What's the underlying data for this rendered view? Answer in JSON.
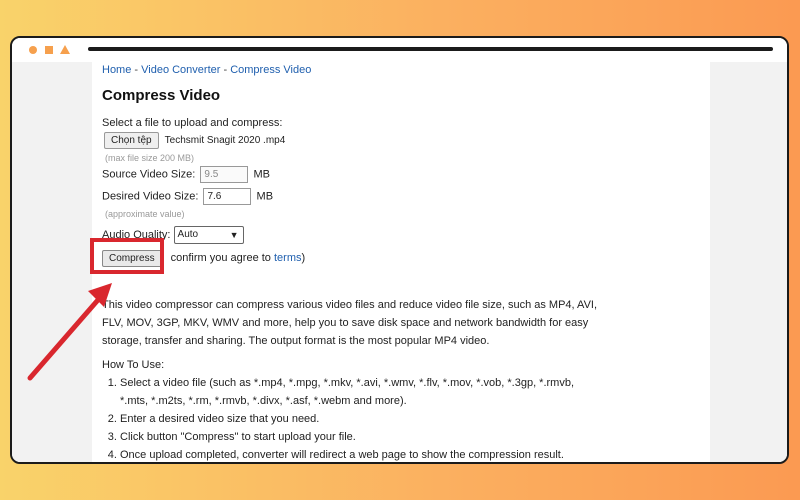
{
  "breadcrumb": {
    "home": "Home",
    "sep": " - ",
    "converter": "Video Converter",
    "current": "Compress Video"
  },
  "page_title": "Compress Video",
  "form": {
    "select_label": "Select a file to upload and compress:",
    "choose_button": "Chọn tệp",
    "file_name": "Techsmit Snagit 2020 .mp4",
    "max_size_hint": "(max file size 200 MB)",
    "source_label": "Source Video Size:",
    "source_value": "9.5",
    "unit": "MB",
    "desired_label": "Desired Video Size:",
    "desired_value": "7.6",
    "approx_hint": "(approximate value)",
    "audio_label": "Audio Quality:",
    "audio_value": "Auto",
    "compress_button": "Compress",
    "confirm_text": "confirm you agree to",
    "terms_link": "terms",
    "confirm_close": ")"
  },
  "description": "This video compressor can compress various video files and reduce video file size, such as MP4, AVI, FLV, MOV, 3GP, MKV, WMV and more, help you to save disk space and network bandwidth for easy storage, transfer and sharing. The output format is the most popular MP4 video.",
  "how_to": {
    "heading": "How To Use:",
    "steps": [
      "Select a video file (such as *.mp4, *.mpg, *.mkv, *.avi, *.wmv, *.flv, *.mov, *.vob, *.3gp, *.rmvb, *.mts, *.m2ts, *.rm, *.rmvb, *.divx, *.asf, *.webm and more).",
      "Enter a desired video size that you need.",
      "Click button \"Compress\" to start upload your file.",
      "Once upload completed, converter will redirect a web page to show the compression result."
    ]
  },
  "colors": {
    "accent_link": "#1f5fae",
    "highlight": "#d9272e",
    "window_icons": "#f6a04d"
  }
}
